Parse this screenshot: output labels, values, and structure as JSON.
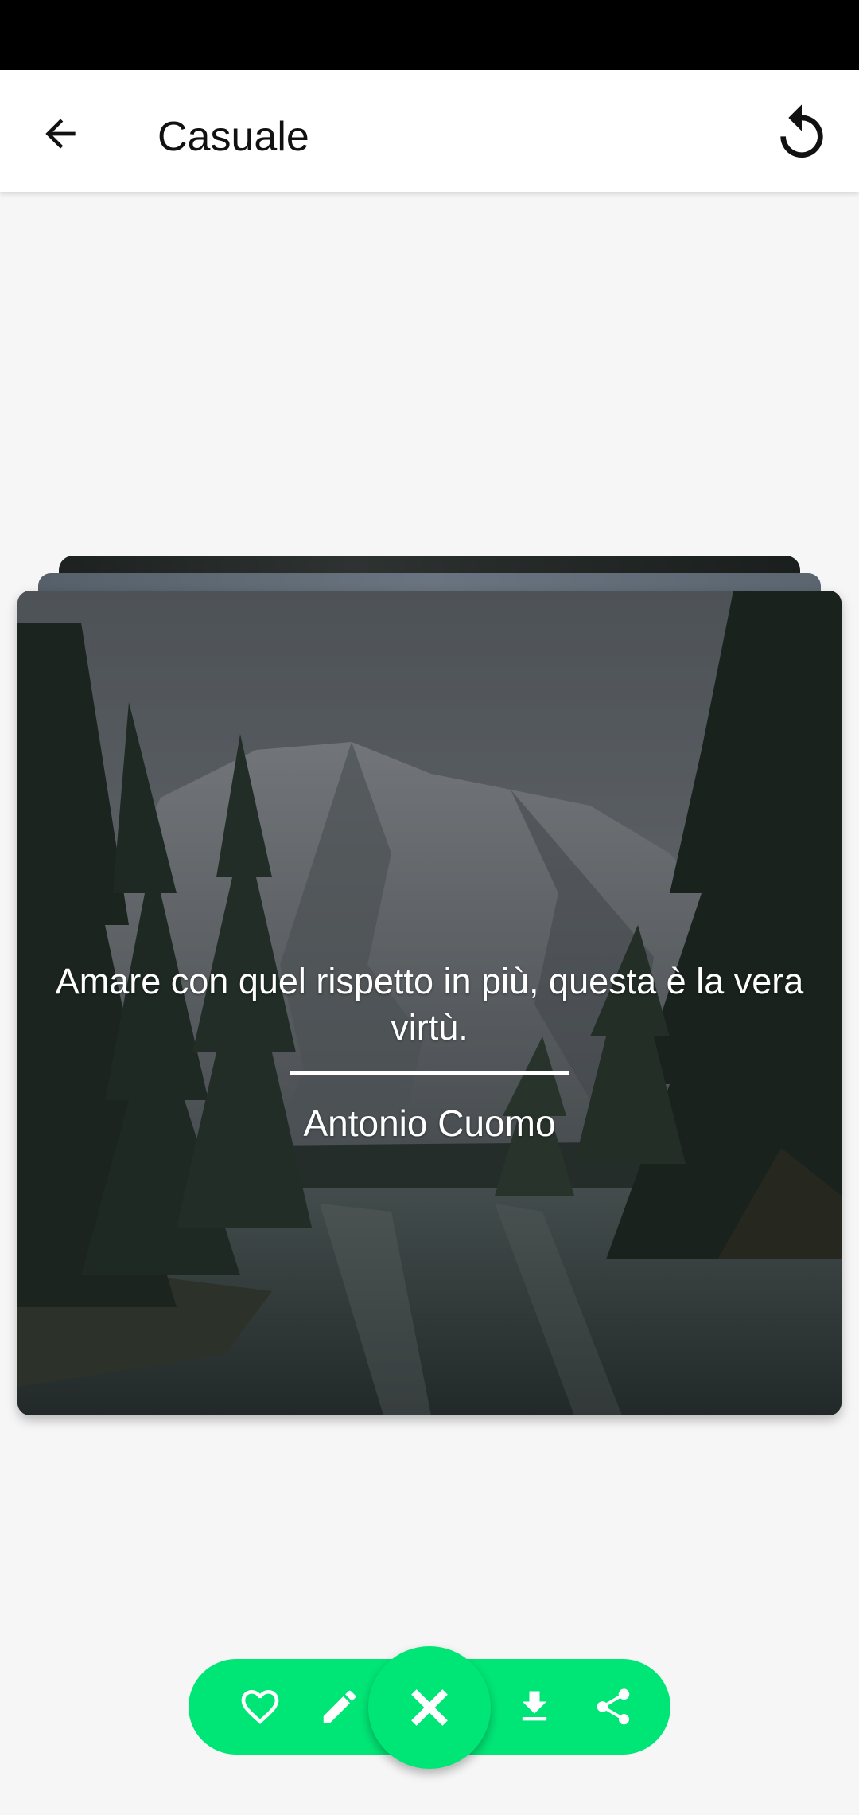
{
  "app_bar": {
    "title": "Casuale",
    "back_icon": "arrow-back-icon",
    "refresh_icon": "refresh-icon"
  },
  "quote": {
    "text": "Amare con quel rispetto in più, questa è la vera virtù.",
    "author": "Antonio Cuomo"
  },
  "actions": {
    "icons": [
      "heart-icon",
      "edit-icon",
      "close-icon",
      "download-icon",
      "share-icon"
    ]
  },
  "colors": {
    "accent": "#00e676",
    "status_bar": "#000000",
    "app_bar": "#ffffff",
    "background": "#f6f6f6"
  }
}
